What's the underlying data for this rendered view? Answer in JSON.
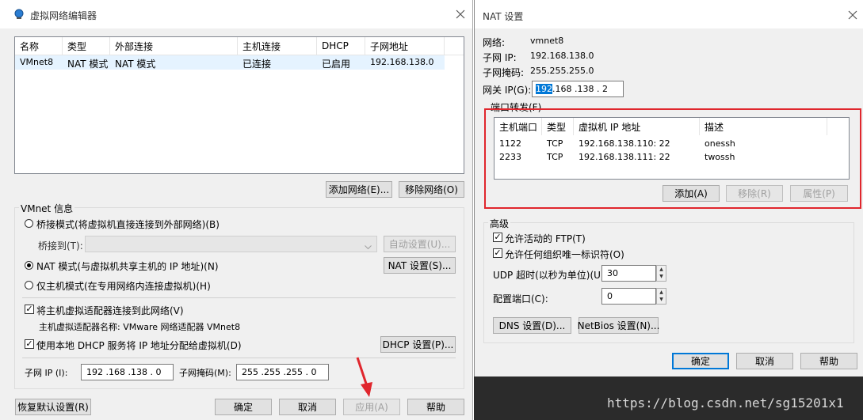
{
  "left_window": {
    "title": "虚拟网络编辑器",
    "table": {
      "columns": [
        "名称",
        "类型",
        "外部连接",
        "主机连接",
        "DHCP",
        "子网地址"
      ],
      "rows": [
        [
          "VMnet8",
          "NAT 模式",
          "NAT 模式",
          "已连接",
          "已启用",
          "192.168.138.0"
        ]
      ]
    },
    "add_network_label": "添加网络(E)...",
    "remove_network_label": "移除网络(O)",
    "vmnet_info_label": "VMnet 信息",
    "bridge_mode_label": "桥接模式(将虚拟机直接连接到外部网络)(B)",
    "bridge_to_label": "桥接到(T):",
    "bridge_to_value": "",
    "auto_settings_label": "自动设置(U)...",
    "nat_mode_label": "NAT 模式(与虚拟机共享主机的 IP 地址)(N)",
    "nat_settings_label": "NAT 设置(S)...",
    "host_only_label": "仅主机模式(在专用网络内连接虚拟机)(H)",
    "connect_adapter_label": "将主机虚拟适配器连接到此网络(V)",
    "adapter_name_label": "主机虚拟适配器名称: VMware 网络适配器 VMnet8",
    "use_dhcp_label": "使用本地 DHCP 服务将 IP 地址分配给虚拟机(D)",
    "dhcp_settings_label": "DHCP 设置(P)...",
    "subnet_ip_label": "子网 IP (I):",
    "subnet_ip_value": "192 .168 .138 .  0",
    "subnet_mask_label": "子网掩码(M):",
    "subnet_mask_value": "255 .255 .255 .  0",
    "restore_defaults_label": "恢复默认设置(R)",
    "ok_label": "确定",
    "cancel_label": "取消",
    "apply_label": "应用(A)",
    "help_label": "帮助"
  },
  "nat_window": {
    "title": "NAT 设置",
    "network_label": "网络:",
    "network_value": "vmnet8",
    "subnet_ip_label": "子网 IP:",
    "subnet_ip_value": "192.168.138.0",
    "subnet_mask_label": "子网掩码:",
    "subnet_mask_value": "255.255.255.0",
    "gateway_label": "网关 IP(G):",
    "gateway_first": "192",
    "gateway_rest": " .168 .138 .  2",
    "port_forward_label": "端口转发(F)",
    "pf_columns": [
      "主机端口",
      "类型",
      "虚拟机 IP 地址",
      "描述"
    ],
    "pf_rows": [
      [
        "1122",
        "TCP",
        "192.168.138.110: 22",
        "onessh"
      ],
      [
        "2233",
        "TCP",
        "192.168.138.111: 22",
        "twossh"
      ]
    ],
    "add_label": "添加(A)",
    "remove_label": "移除(R)",
    "properties_label": "属性(P)",
    "advanced_label": "高级",
    "allow_ftp_label": "允许活动的 FTP(T)",
    "allow_oui_label": "允许任何组织唯一标识符(O)",
    "udp_timeout_label": "UDP 超时(以秒为单位)(U):",
    "udp_timeout_value": "30",
    "config_port_label": "配置端口(C):",
    "config_port_value": "0",
    "dns_settings_label": "DNS 设置(D)...",
    "netbios_settings_label": "NetBios 设置(N)...",
    "ok_label": "确定",
    "cancel_label": "取消",
    "help_label": "帮助"
  },
  "watermark": "https://blog.csdn.net/sg15201x1",
  "colors": {
    "highlight_box": "#e0262d",
    "selection": "#0078d7",
    "annotation_arrow": "#e0262d"
  }
}
